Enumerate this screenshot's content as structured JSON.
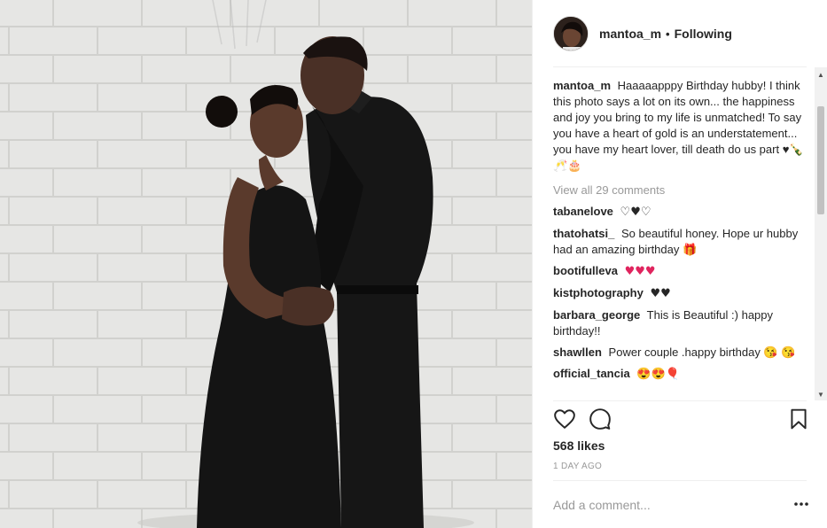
{
  "header": {
    "username": "mantoa_m",
    "separator": "•",
    "follow_label": "Following"
  },
  "caption": {
    "username": "mantoa_m",
    "text": "Haaaaapppy Birthday hubby! I think this photo says a lot on its own... the happiness and joy you bring to my life is unmatched! To say you have a heart of gold is an understatement... you have my heart lover, till death do us part ♥🍾🥂🎂"
  },
  "view_all_label": "View all 29 comments",
  "comments": [
    {
      "username": "tabanelove",
      "text": "♡♥♡"
    },
    {
      "username": "thatohatsi_",
      "text": "So beautiful honey. Hope ur hubby had an amazing birthday 🎁"
    },
    {
      "username": "bootifulleva",
      "text": "♥♥♥"
    },
    {
      "username": "kistphotography",
      "text": "♥♥"
    },
    {
      "username": "barbara_george",
      "text": "This is Beautiful :) happy birthday!!"
    },
    {
      "username": "shawllen",
      "text": "Power couple .happy birthday 😘 😘"
    },
    {
      "username": "official_tancia",
      "text": "😍😍🎈"
    }
  ],
  "actions": {
    "like_icon": "heart-outline-icon",
    "comment_icon": "speech-bubble-icon",
    "save_icon": "bookmark-icon"
  },
  "likes_label": "568 likes",
  "timestamp": "1 DAY AGO",
  "comment_input": {
    "placeholder": "Add a comment..."
  },
  "more_icon": "ellipsis-icon",
  "colors": {
    "text": "#262626",
    "muted": "#999999",
    "divider": "#efefef",
    "accent_red": "#e0245e"
  }
}
